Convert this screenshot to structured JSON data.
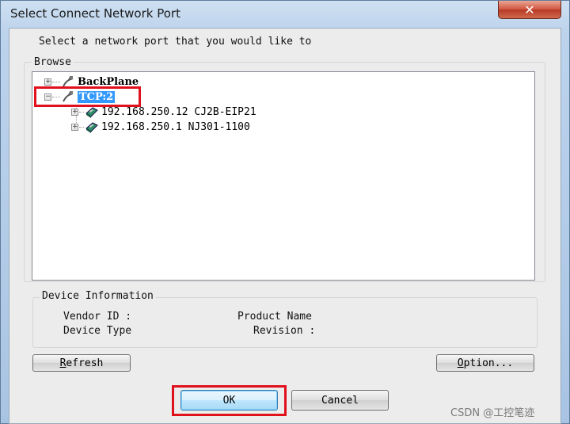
{
  "window": {
    "title": "Select Connect Network Port",
    "close_symbol": "✕"
  },
  "instruction": "Select a network port that you would like to",
  "browse": {
    "label": "Browse",
    "tree": [
      {
        "label": "BackPlane",
        "expander": "+",
        "icon": "cable-icon"
      },
      {
        "label": "TCP:2",
        "expander": "−",
        "icon": "cable-icon",
        "selected": true
      },
      {
        "label": "192.168.250.12 CJ2B-EIP21",
        "expander": "+",
        "icon": "plc-device-icon"
      },
      {
        "label": "192.168.250.1 NJ301-1100",
        "expander": "+",
        "icon": "plc-device-icon"
      }
    ]
  },
  "device_info": {
    "label": "Device Information",
    "vendor_id": "Vendor ID :",
    "product_name": "Product Name",
    "device_type": "Device Type",
    "revision": "Revision :"
  },
  "buttons": {
    "refresh_first": "R",
    "refresh_rest": "efresh",
    "option_first": "O",
    "option_rest": "ption...",
    "ok": "OK",
    "cancel": "Cancel"
  },
  "watermark": "CSDN @工控笔迹",
  "colors": {
    "highlight_box": "#e0101c",
    "selection": "#3399ff"
  }
}
